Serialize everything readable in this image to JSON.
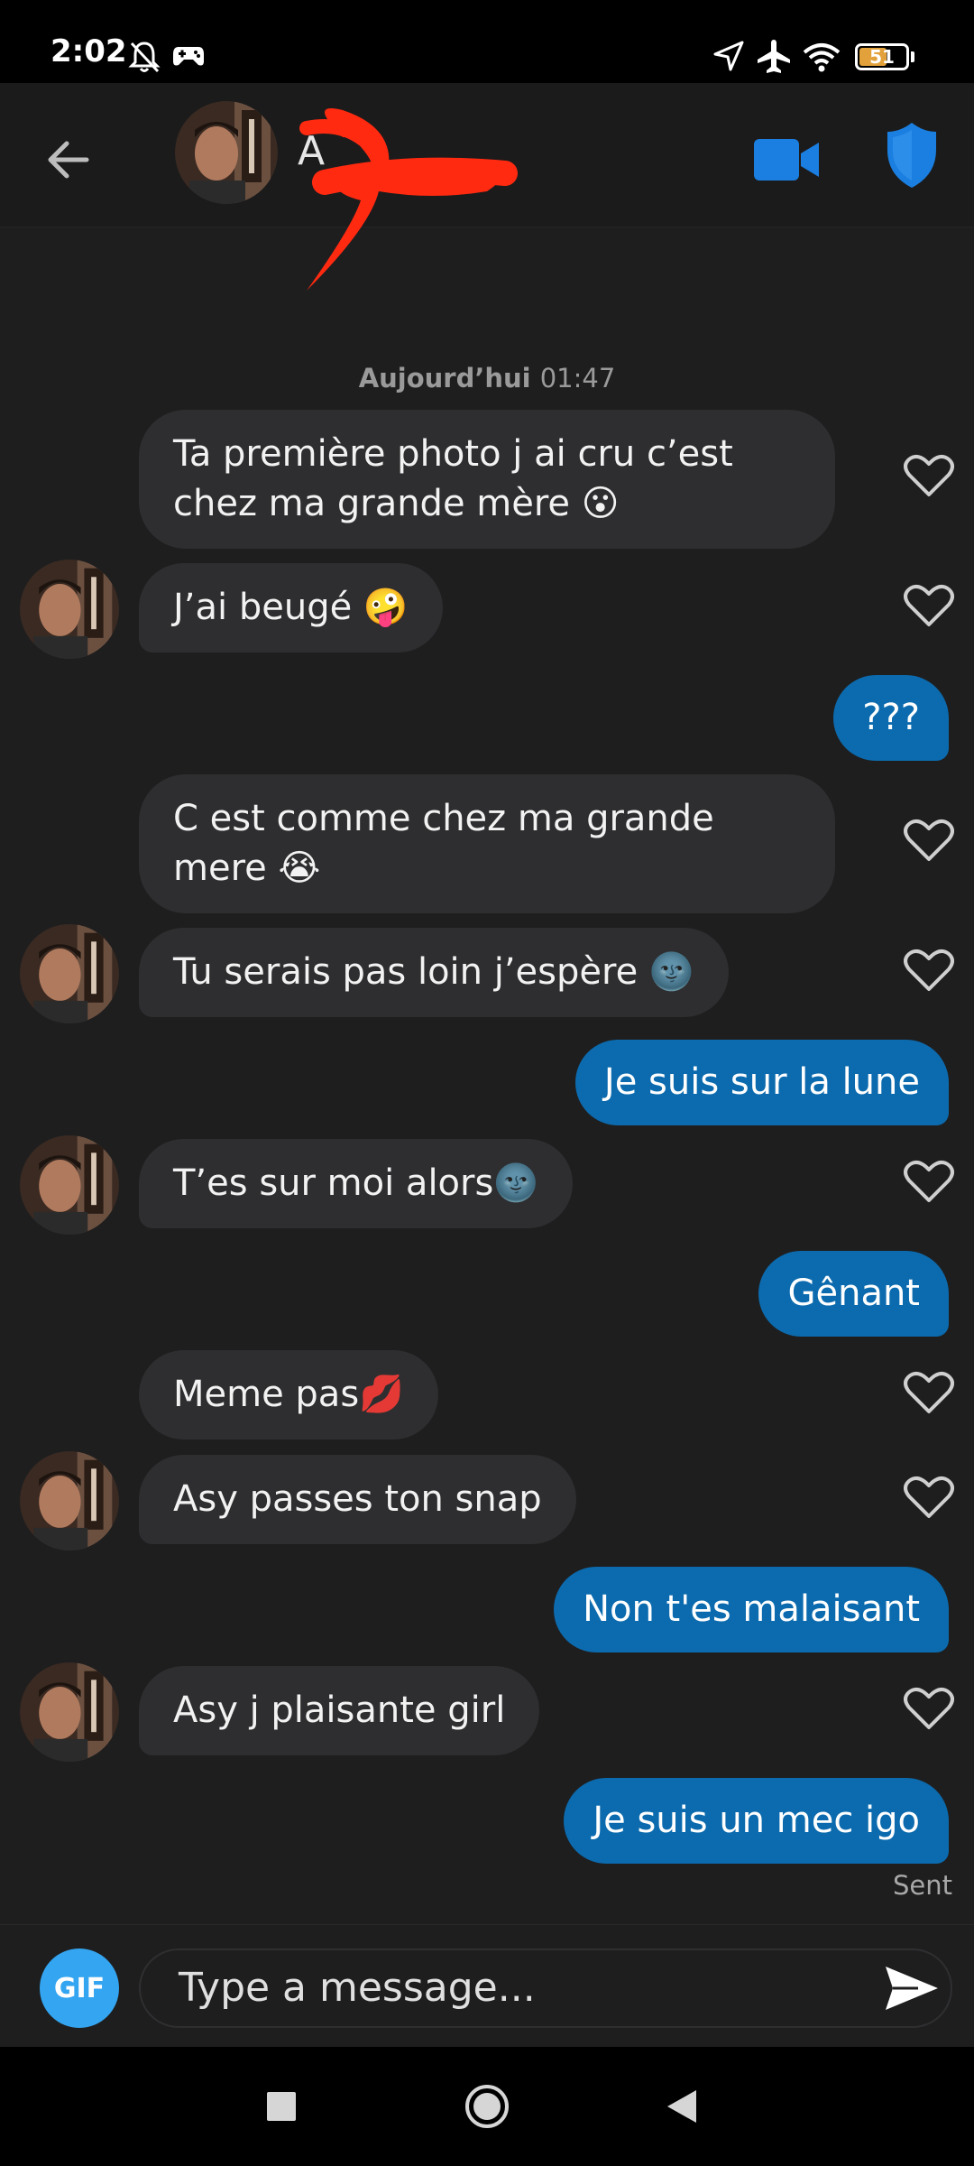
{
  "status_bar": {
    "time": "2:02",
    "battery_level": "51",
    "icons": [
      "bell-off-icon",
      "game-controller-icon",
      "location-arrow-icon",
      "airplane-icon",
      "wifi-icon",
      "battery-icon"
    ]
  },
  "header": {
    "contact_name": "A",
    "icons": [
      "back-arrow-icon",
      "video-camera-icon",
      "shield-icon"
    ],
    "accent_color": "#1a7fe0"
  },
  "chat": {
    "date_label": "Aujourd’hui",
    "date_time": "01:47",
    "messages": [
      {
        "dir": "in",
        "text": "Ta première photo j ai cru c’est chez ma grande mère 😮"
      },
      {
        "dir": "in",
        "text": "J’ai beugé 🤪"
      },
      {
        "dir": "out",
        "text": "???"
      },
      {
        "dir": "in",
        "text": "C est comme chez ma grande mere 😭"
      },
      {
        "dir": "in",
        "text": "Tu serais pas loin j’espère 🌚"
      },
      {
        "dir": "out",
        "text": "Je suis sur la lune"
      },
      {
        "dir": "in",
        "text": "T’es sur moi alors🌚"
      },
      {
        "dir": "out",
        "text": "Gênant"
      },
      {
        "dir": "in",
        "text": "Meme pas💋"
      },
      {
        "dir": "in",
        "text": "Asy passes ton snap"
      },
      {
        "dir": "out",
        "text": "Non t'es malaisant"
      },
      {
        "dir": "in",
        "text": "Asy j plaisante girl"
      },
      {
        "dir": "out",
        "text": "Je suis un mec igo"
      }
    ],
    "sent_label": "Sent",
    "outgoing_color": "#0c6bae",
    "incoming_color": "#2e2e30"
  },
  "composer": {
    "gif_label": "GIF",
    "placeholder": "Type a message...",
    "send_icon": "send-icon"
  },
  "navbar": {
    "icons": [
      "recents-square-icon",
      "home-circle-icon",
      "back-triangle-icon"
    ]
  }
}
